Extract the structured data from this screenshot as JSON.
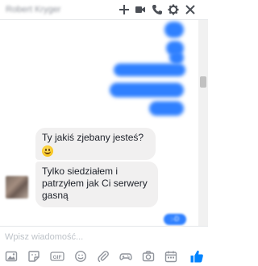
{
  "header": {
    "contact_name": "Robert Kryger",
    "icons": [
      "plus-icon",
      "video-icon",
      "phone-icon",
      "gear-icon",
      "close-icon"
    ]
  },
  "conversation": {
    "received": [
      {
        "text": "Ty jakiś zjebany jesteś?",
        "emoji": "grinning-face"
      },
      {
        "text": "Tylko siedziałem i patrzyłem jak Ci serwery gasną"
      }
    ],
    "seen_badge": ":-D"
  },
  "composer": {
    "placeholder": "Wpisz wiadomość...",
    "value": ""
  },
  "toolbar": {
    "icons": [
      "image-icon",
      "sticker-icon",
      "gif-icon",
      "emoji-icon",
      "paperclip-icon",
      "gamepad-icon",
      "camera-icon",
      "calendar-icon",
      "like-icon"
    ],
    "gif_label": "GIF"
  },
  "colors": {
    "accent": "#2f80ff",
    "received_bubble": "#f1f0f0",
    "icon": "#90949c",
    "header_icon": "#4b4f56",
    "like": "#0084ff"
  }
}
